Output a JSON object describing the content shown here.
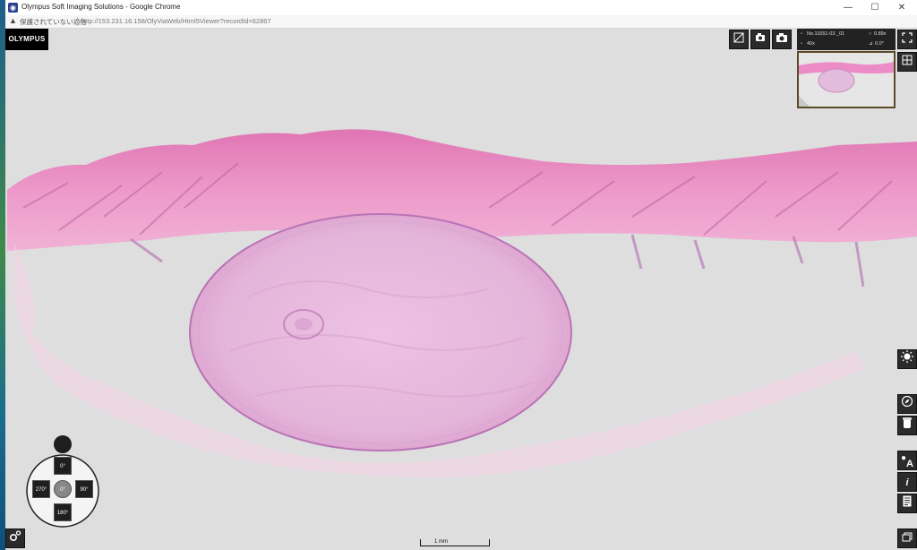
{
  "window": {
    "title": "Olympus Soft Imaging Solutions - Google Chrome",
    "minimize": "—",
    "maximize": "☐",
    "close": "✕"
  },
  "address": {
    "security_label": "保護されていない通信",
    "url": "http://153.231.16.158/OlyViaWeb/Html5Viewer?recordId=62867"
  },
  "viewer": {
    "logo": "OLYMPUS",
    "toolbar": {
      "snapshot_label": "📷"
    },
    "info": {
      "slide_id": "No.11651-03 _01",
      "magnification": "40x",
      "zoom": "0.89x",
      "rotation": "0.0°"
    },
    "rotation": {
      "top": "0°",
      "left": "270°",
      "center": "0°",
      "right": "90°",
      "bottom": "180°"
    },
    "scale_bar": "1 mm",
    "side_buttons": {
      "annotation_label": "A",
      "info_label": "i"
    }
  },
  "colors": {
    "tissue_pink": "#ea8ac4",
    "cyst": "#e2b7da",
    "background": "#dedede"
  }
}
